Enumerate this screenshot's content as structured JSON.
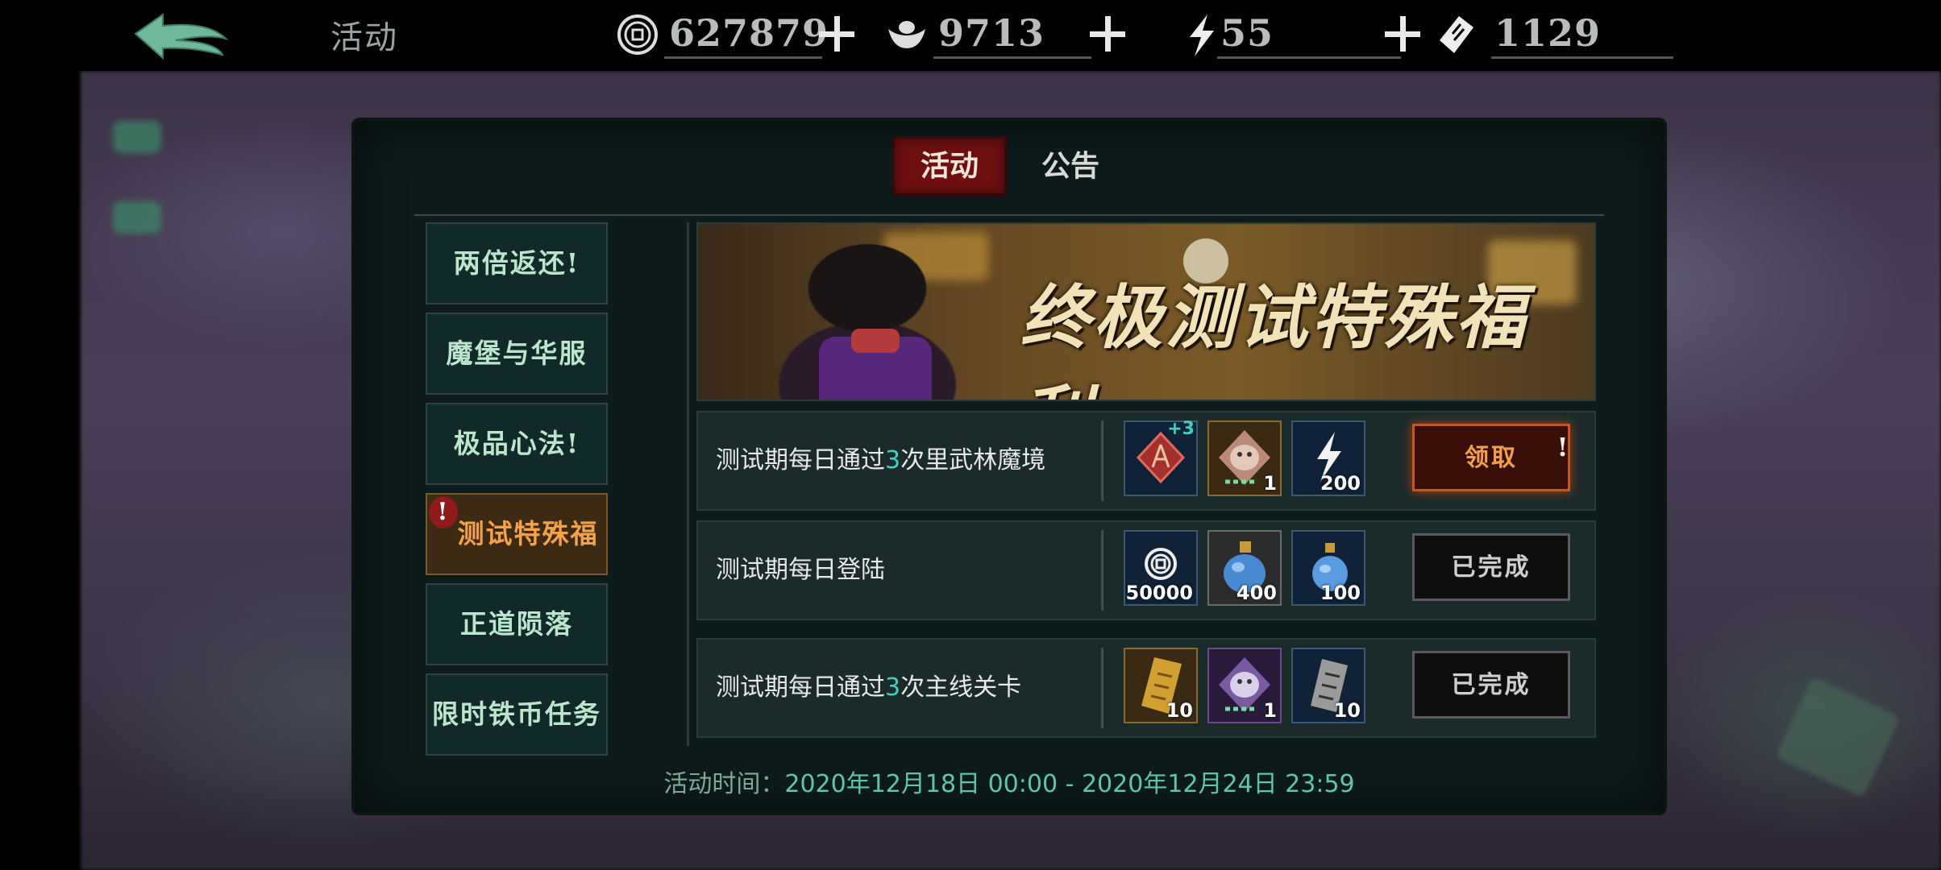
{
  "topbar": {
    "title": "活动",
    "resources": [
      {
        "icon": "copper-coin-icon",
        "value": "627879"
      },
      {
        "icon": "silver-ingot-icon",
        "value": "9713"
      },
      {
        "icon": "lightning-stamina-icon",
        "value": "55"
      },
      {
        "icon": "ticket-icon",
        "value": "1129"
      }
    ]
  },
  "tabs": [
    {
      "label": "活动",
      "active": true
    },
    {
      "label": "公告",
      "active": false
    }
  ],
  "sidebar": [
    {
      "label": "两倍返还!"
    },
    {
      "label": "魔堡与华服"
    },
    {
      "label": "极品心法!"
    },
    {
      "label": "测试特殊福利",
      "active": true,
      "alert": "!"
    },
    {
      "label": "正道陨落"
    },
    {
      "label": "限时铁币任务"
    }
  ],
  "banner": {
    "title": "终极测试特殊福利"
  },
  "tasks": [
    {
      "desc_pre": "测试期每日通过",
      "desc_num": "3",
      "desc_post": "次里武林魔境",
      "rewards": [
        {
          "icon": "red-token-icon",
          "badge": "+3",
          "count": ""
        },
        {
          "icon": "spirit-pet-icon",
          "count": "1"
        },
        {
          "icon": "lightning-stamina-icon",
          "count": "200"
        }
      ],
      "button": "领取",
      "claim_alert": "!"
    },
    {
      "desc_pre": "测试期每日登陆",
      "desc_num": "",
      "desc_post": "",
      "rewards": [
        {
          "icon": "copper-coin-icon",
          "count": "50000"
        },
        {
          "icon": "blue-potion-icon",
          "count": "400"
        },
        {
          "icon": "blue-potion-small-icon",
          "count": "100"
        }
      ],
      "button": "已完成"
    },
    {
      "desc_pre": "测试期每日通过",
      "desc_num": "3",
      "desc_post": "次主线关卡",
      "rewards": [
        {
          "icon": "gold-ticket-icon",
          "count": "10"
        },
        {
          "icon": "spirit-pet-purple-icon",
          "count": "1"
        },
        {
          "icon": "silver-ticket-icon",
          "count": "10"
        }
      ],
      "button": "已完成"
    }
  ],
  "footer": {
    "label": "活动时间：",
    "start": "2020年12月18日 00:00",
    "sep": " - ",
    "end": "2020年12月24日 23:59"
  }
}
